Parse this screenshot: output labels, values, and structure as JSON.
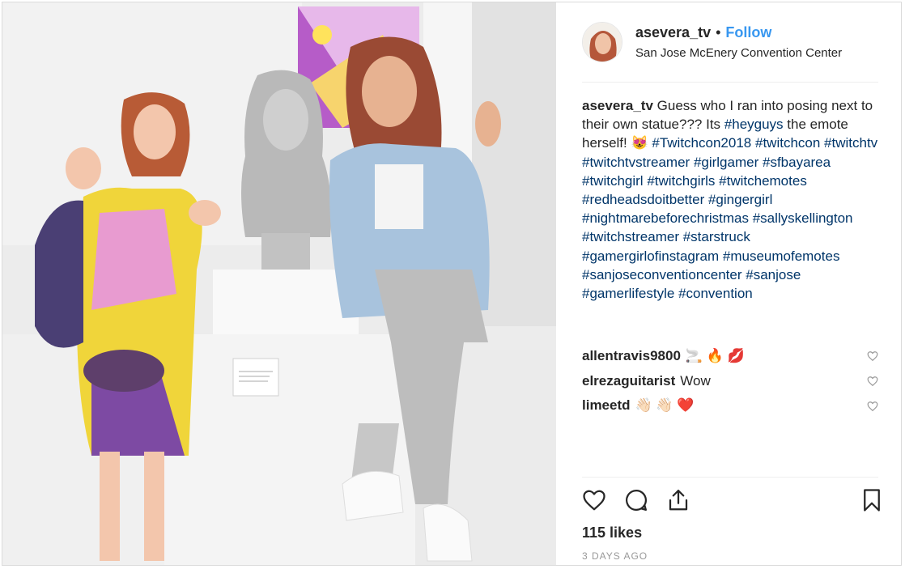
{
  "post": {
    "username": "asevera_tv",
    "separator": "•",
    "follow_label": "Follow",
    "location": "San Jose McEnery Convention Center",
    "caption": {
      "username": "asevera_tv",
      "segments": [
        {
          "t": "text",
          "v": " Guess who I ran into posing next to their own statue??? Its "
        },
        {
          "t": "tag",
          "v": "#heyguys"
        },
        {
          "t": "text",
          "v": " the emote herself! 😻  "
        },
        {
          "t": "tag",
          "v": "#Twitchcon2018"
        },
        {
          "t": "text",
          "v": " "
        },
        {
          "t": "tag",
          "v": "#twitchcon"
        },
        {
          "t": "text",
          "v": " "
        },
        {
          "t": "tag",
          "v": "#twitchtv"
        },
        {
          "t": "text",
          "v": " "
        },
        {
          "t": "tag",
          "v": "#twitchtvstreamer"
        },
        {
          "t": "text",
          "v": " "
        },
        {
          "t": "tag",
          "v": "#girlgamer"
        },
        {
          "t": "text",
          "v": " "
        },
        {
          "t": "tag",
          "v": "#sfbayarea"
        },
        {
          "t": "text",
          "v": " "
        },
        {
          "t": "tag",
          "v": "#twitchgirl"
        },
        {
          "t": "text",
          "v": " "
        },
        {
          "t": "tag",
          "v": "#twitchgirls"
        },
        {
          "t": "text",
          "v": " "
        },
        {
          "t": "tag",
          "v": "#twitchemotes"
        },
        {
          "t": "text",
          "v": " "
        },
        {
          "t": "tag",
          "v": "#redheadsdoitbetter"
        },
        {
          "t": "text",
          "v": " "
        },
        {
          "t": "tag",
          "v": "#gingergirl"
        },
        {
          "t": "text",
          "v": " "
        },
        {
          "t": "tag",
          "v": "#nightmarebeforechristmas"
        },
        {
          "t": "text",
          "v": " "
        },
        {
          "t": "tag",
          "v": "#sallyskellington"
        },
        {
          "t": "text",
          "v": " "
        },
        {
          "t": "tag",
          "v": "#twitchstreamer"
        },
        {
          "t": "text",
          "v": " "
        },
        {
          "t": "tag",
          "v": "#starstruck"
        },
        {
          "t": "text",
          "v": " "
        },
        {
          "t": "tag",
          "v": "#gamergirlofinstagram"
        },
        {
          "t": "text",
          "v": " "
        },
        {
          "t": "tag",
          "v": "#museumofemotes"
        },
        {
          "t": "text",
          "v": " "
        },
        {
          "t": "tag",
          "v": "#sanjoseconventioncenter"
        },
        {
          "t": "text",
          "v": " "
        },
        {
          "t": "tag",
          "v": "#sanjose"
        },
        {
          "t": "text",
          "v": " "
        },
        {
          "t": "tag",
          "v": "#gamerlifestyle"
        },
        {
          "t": "text",
          "v": " "
        },
        {
          "t": "tag",
          "v": "#convention"
        }
      ]
    },
    "comments": [
      {
        "user": "allentravis9800",
        "text": "🚬 🔥 💋"
      },
      {
        "user": "elrezaguitarist",
        "text": "Wow"
      },
      {
        "user": "limeetd",
        "text": "👋🏻 👋🏻 ❤️"
      }
    ],
    "actions": {
      "like_icon": "heart-icon",
      "comment_icon": "comment-icon",
      "share_icon": "share-icon",
      "save_icon": "bookmark-icon"
    },
    "likes": "115 likes",
    "date": "3 DAYS AGO",
    "colors": {
      "link": "#3897f0",
      "hashtag": "#003569",
      "text": "#262626",
      "muted": "#999999",
      "divider": "#efefef"
    }
  }
}
